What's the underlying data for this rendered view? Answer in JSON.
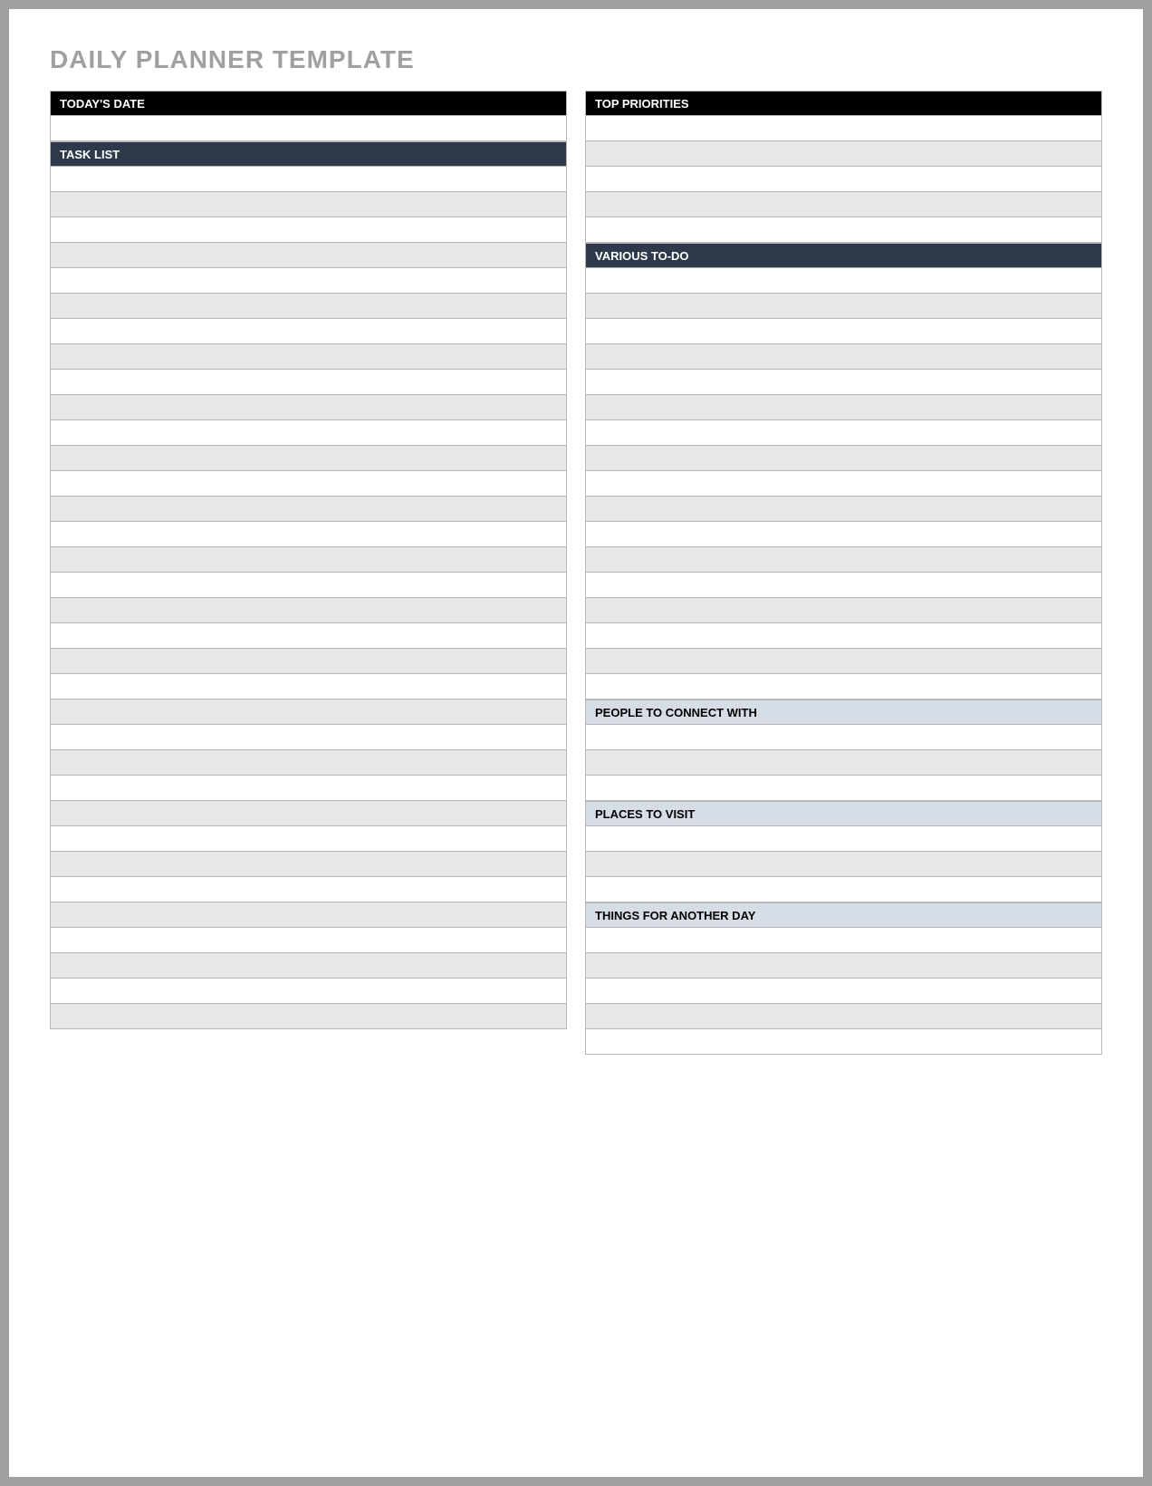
{
  "title": "DAILY PLANNER TEMPLATE",
  "left": {
    "date_header": "TODAY'S DATE",
    "tasklist_header": "TASK LIST"
  },
  "right": {
    "priorities_header": "TOP PRIORITIES",
    "todo_header": "VARIOUS TO-DO",
    "people_header": "PEOPLE TO CONNECT WITH",
    "places_header": "PLACES TO VISIT",
    "another_header": "THINGS FOR ANOTHER DAY"
  },
  "row_counts": {
    "date_rows": 1,
    "tasklist_rows": 34,
    "priorities_rows": 5,
    "todo_rows": 17,
    "people_rows": 3,
    "places_rows": 3,
    "another_rows": 5
  }
}
